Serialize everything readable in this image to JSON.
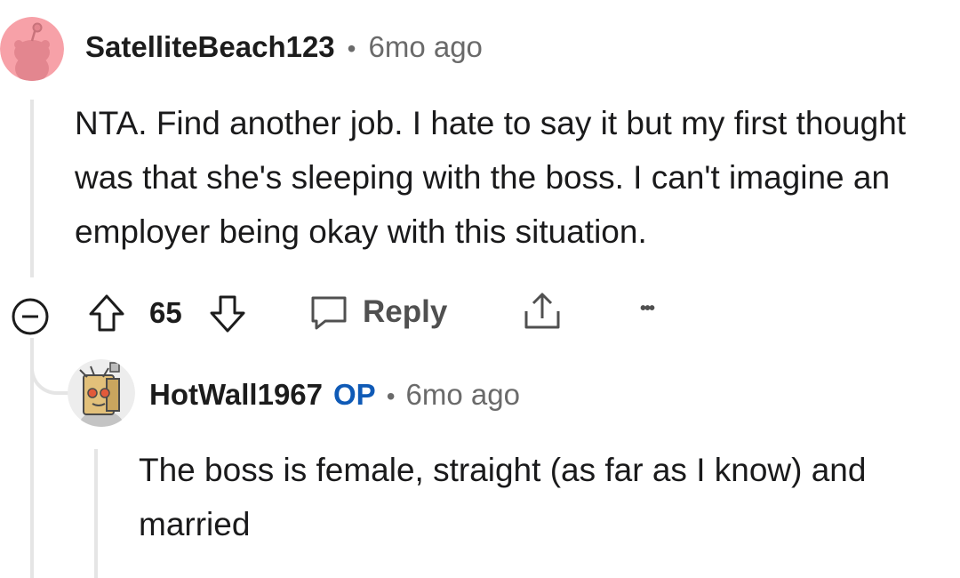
{
  "comment": {
    "username": "SatelliteBeach123",
    "separator": "•",
    "time": "6mo ago",
    "body": "NTA. Find another job. I hate to say it but my first thought was that she's sleeping with the boss. I can't imagine an employer being okay with this situation.",
    "score": "65",
    "reply_label": "Reply",
    "more_label": "•••",
    "avatar_color": "#f7a1a8"
  },
  "reply": {
    "username": "HotWall1967",
    "op_badge": "OP",
    "separator": "•",
    "time": "6mo ago",
    "body": "The boss is female, straight (as far as I know) and married",
    "op_color": "#0f5ab6"
  }
}
